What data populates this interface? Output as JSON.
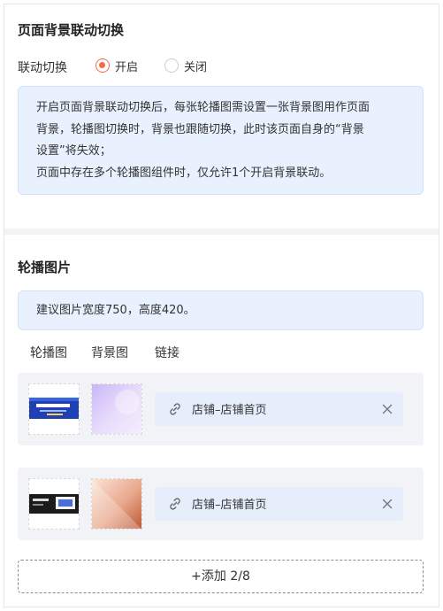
{
  "section1": {
    "title": "页面背景联动切换",
    "toggle_label": "联动切换",
    "options": [
      {
        "label": "开启",
        "selected": true
      },
      {
        "label": "关闭",
        "selected": false
      }
    ],
    "note_lines": [
      "开启页面背景联动切换后，每张轮播图需设置一张背景图用作页面",
      "背景，轮播图切换时，背景也跟随切换，此时该页面自身的“背景",
      "设置”将失效；",
      "页面中存在多个轮播图组件时，仅允许1个开启背景联动。"
    ]
  },
  "section2": {
    "title": "轮播图片",
    "note": "建议图片宽度750，高度420。",
    "columns": [
      "轮播图",
      "背景图",
      "链接"
    ],
    "items": [
      {
        "link_text": "店铺–店铺首页",
        "carousel_icon": "banner-thumbnail",
        "background_icon": "purple-gradient-thumbnail"
      },
      {
        "link_text": "店铺–店铺首页",
        "carousel_icon": "dark-banner-thumbnail",
        "background_icon": "peach-gradient-thumbnail"
      }
    ],
    "add_button": "+添加 2/8"
  },
  "colors": {
    "accent": "#f56a4b",
    "note_bg": "#e8f1fd",
    "card_bg": "#f2f3f7",
    "link_bg": "#e6eefc"
  }
}
